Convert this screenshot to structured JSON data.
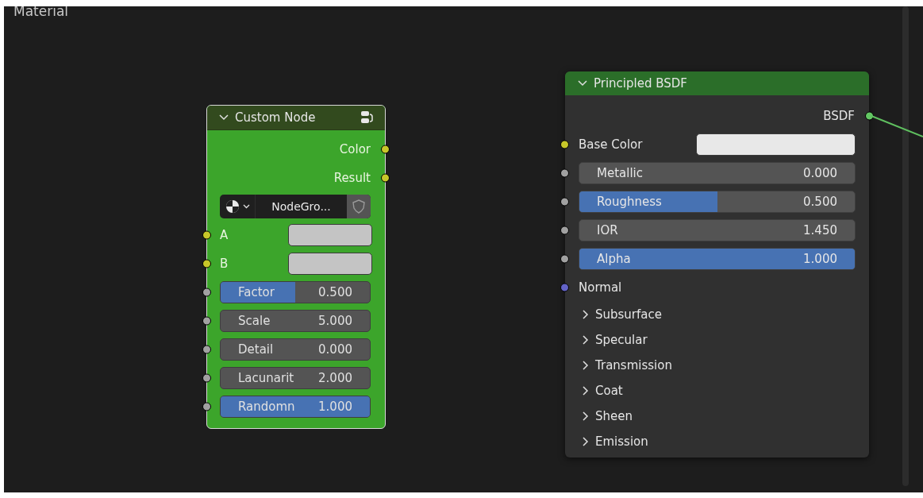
{
  "editor": {
    "title": "Material"
  },
  "custom_node": {
    "title": "Custom Node",
    "expanded": true,
    "outputs": [
      {
        "label": "Color",
        "color": "#c7c729"
      },
      {
        "label": "Result",
        "color": "#c7c729"
      }
    ],
    "datablock": {
      "name": "NodeGro..."
    },
    "inputs": [
      {
        "kind": "color",
        "label": "A",
        "color": "#c7c729",
        "swatch": {
          "color": "#c4c4c4"
        }
      },
      {
        "kind": "color",
        "label": "B",
        "color": "#c7c729",
        "swatch": {
          "color": "#c4c4c4"
        }
      },
      {
        "kind": "slider",
        "label": "Factor",
        "value": "0.500",
        "level": 0.5,
        "color": "#a1a1a1"
      },
      {
        "kind": "number",
        "label": "Scale",
        "value": "5.000",
        "color": "#a1a1a1"
      },
      {
        "kind": "number",
        "label": "Detail",
        "value": "0.000",
        "color": "#a1a1a1"
      },
      {
        "kind": "number",
        "label": "Lacunarit",
        "value": "2.000",
        "color": "#a1a1a1"
      },
      {
        "kind": "slider",
        "label": "Randomn",
        "value": "1.000",
        "level": 1,
        "color": "#a1a1a1"
      }
    ]
  },
  "principled_node": {
    "title": "Principled BSDF",
    "expanded": true,
    "outputs": [
      {
        "label": "BSDF",
        "color": "#63c763"
      }
    ],
    "inputs": [
      {
        "kind": "color",
        "label": "Base Color",
        "color": "#c7c729",
        "swatch": {
          "color": "#e8e8e8"
        }
      },
      {
        "kind": "number",
        "label": "Metallic",
        "value": "0.000",
        "color": "#a1a1a1"
      },
      {
        "kind": "slider",
        "label": "Roughness",
        "value": "0.500",
        "level": 0.5,
        "color": "#a1a1a1"
      },
      {
        "kind": "number",
        "label": "IOR",
        "value": "1.450",
        "color": "#a1a1a1"
      },
      {
        "kind": "slider",
        "label": "Alpha",
        "value": "1.000",
        "level": 1,
        "color": "#a1a1a1"
      },
      {
        "kind": "vector",
        "label": "Normal",
        "color": "#6363c7"
      }
    ],
    "panels": [
      {
        "label": "Subsurface",
        "expanded": false
      },
      {
        "label": "Specular",
        "expanded": false
      },
      {
        "label": "Transmission",
        "expanded": false
      },
      {
        "label": "Coat",
        "expanded": false
      },
      {
        "label": "Sheen",
        "expanded": false
      },
      {
        "label": "Emission",
        "expanded": false
      }
    ]
  }
}
